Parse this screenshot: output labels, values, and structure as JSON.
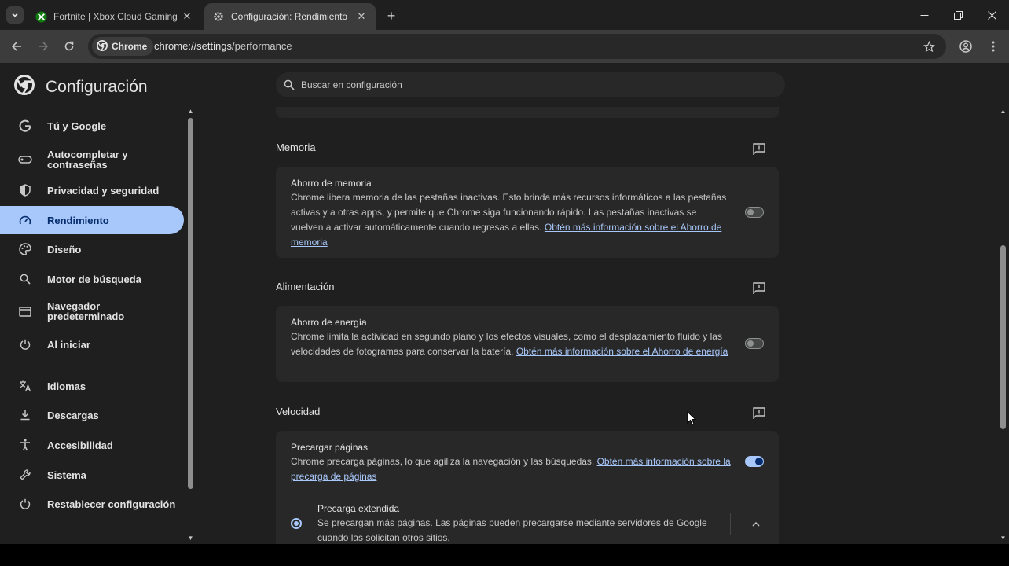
{
  "browser": {
    "tabs": [
      {
        "title": "Fortnite | Xbox Cloud Gaming (",
        "icon": "xbox-icon",
        "active": false
      },
      {
        "title": "Configuración: Rendimiento",
        "icon": "gear-icon",
        "active": true
      }
    ],
    "new_tab": "+",
    "chip_label": "Chrome",
    "url_host": "chrome://settings",
    "url_path": "/performance"
  },
  "settings": {
    "app_title": "Configuración",
    "search_placeholder": "Buscar en configuración",
    "sidebar": [
      {
        "label": "Tú y Google",
        "icon": "google-icon"
      },
      {
        "label": "Autocompletar y contraseñas",
        "icon": "key-icon"
      },
      {
        "label": "Privacidad y seguridad",
        "icon": "shield-icon"
      },
      {
        "label": "Rendimiento",
        "icon": "speedometer-icon",
        "active": true
      },
      {
        "label": "Diseño",
        "icon": "palette-icon"
      },
      {
        "label": "Motor de búsqueda",
        "icon": "search-icon"
      },
      {
        "label": "Navegador predeterminado",
        "icon": "browser-window-icon"
      },
      {
        "label": "Al iniciar",
        "icon": "power-icon"
      },
      {
        "label": "Idiomas",
        "icon": "translate-icon"
      },
      {
        "label": "Descargas",
        "icon": "download-icon"
      },
      {
        "label": "Accesibilidad",
        "icon": "accessibility-icon"
      },
      {
        "label": "Sistema",
        "icon": "wrench-icon"
      },
      {
        "label": "Restablecer configuración",
        "icon": "reset-icon"
      }
    ],
    "sections": {
      "memory": {
        "heading": "Memoria",
        "title": "Ahorro de memoria",
        "desc": "Chrome libera memoria de las pestañas inactivas. Esto brinda más recursos informáticos a las pestañas activas y a otras apps, y permite que Chrome siga funcionando rápido. Las pestañas inactivas se vuelven a activar automáticamente cuando regresas a ellas. ",
        "link": "Obtén más información sobre el Ahorro de memoria",
        "enabled": false
      },
      "power": {
        "heading": "Alimentación",
        "title": "Ahorro de energía",
        "desc": "Chrome limita la actividad en segundo plano y los efectos visuales, como el desplazamiento fluido y las velocidades de fotogramas para conservar la batería. ",
        "link": "Obtén más información sobre el Ahorro de energía",
        "enabled": false
      },
      "speed": {
        "heading": "Velocidad",
        "title": "Precargar páginas",
        "desc": "Chrome precarga páginas, lo que agiliza la navegación y las búsquedas. ",
        "link": "Obtén más información sobre la precarga de páginas",
        "enabled": true,
        "option_title": "Precarga extendida",
        "option_desc": "Se precargan más páginas. Las páginas pueden precargarse mediante servidores de Google cuando las solicitan otros sitios.",
        "option_selected": true
      }
    }
  }
}
